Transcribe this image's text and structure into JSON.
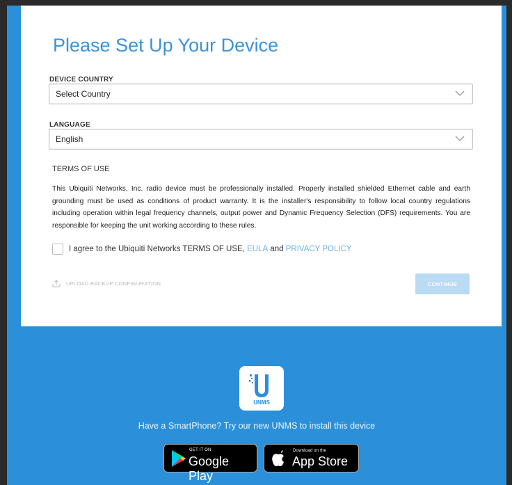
{
  "setup": {
    "title": "Please Set Up Your Device",
    "country": {
      "label": "DEVICE COUNTRY",
      "value": "Select Country"
    },
    "language": {
      "label": "LANGUAGE",
      "value": "English"
    },
    "terms": {
      "heading": "TERMS OF USE",
      "body": "This Ubiquiti Networks, Inc. radio device must be professionally installed. Properly installed shielded Ethernet cable and earth grounding must be used as conditions of product warranty. It is the installer's responsibility to follow local country regulations including operation within legal frequency channels, output power and Dynamic Frequency Selection (DFS) requirements. You are responsible for keeping the unit working according to these rules."
    },
    "agree": {
      "text": "I agree to the Ubiquiti Networks TERMS OF USE, ",
      "eula": "EULA",
      "and": " and ",
      "privacy": "PRIVACY POLICY"
    },
    "upload_label": "UPLOAD BACKUP CONFIGURATION",
    "continue_label": "CONTINUE"
  },
  "footer": {
    "app_logo_text": "UNMS",
    "promo": "Have a SmartPhone? Try our new UNMS to install this device",
    "google_play": {
      "small": "GET IT ON",
      "big": "Google Play"
    },
    "app_store": {
      "small": "Download on the",
      "big": "App Store"
    }
  },
  "colors": {
    "accent": "#2b90d9",
    "title": "#3a93d6",
    "link": "#6cb3e6",
    "button_disabled": "#b9dbf3"
  },
  "icons": [
    "chevron-down-icon",
    "upload-icon",
    "unms-logo-icon",
    "google-play-icon",
    "apple-icon"
  ]
}
